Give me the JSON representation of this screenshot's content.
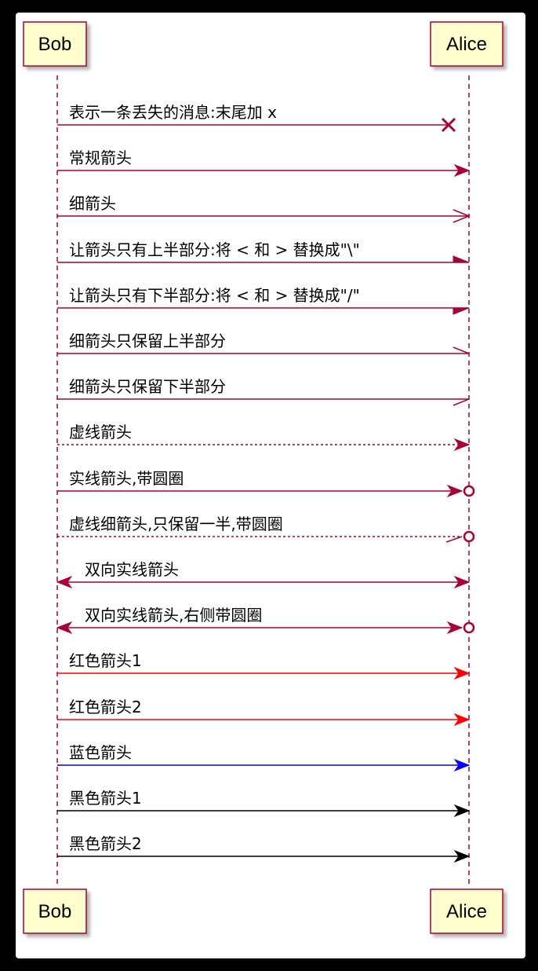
{
  "participants": [
    {
      "name": "Bob"
    },
    {
      "name": "Alice"
    }
  ],
  "colors": {
    "line": "#A80036",
    "box_fill": "#FEFECE",
    "red": "#FF0000",
    "blue": "#0000FF",
    "black": "#000000"
  },
  "messages": [
    {
      "text": "表示一条丢失的消息:末尾加 x",
      "style": "lost",
      "color": "line"
    },
    {
      "text": "常规箭头",
      "style": "solid",
      "color": "line"
    },
    {
      "text": "细箭头",
      "style": "thin",
      "color": "line"
    },
    {
      "text": "让箭头只有上半部分:将 < 和 > 替换成\"\\\"",
      "style": "half-top",
      "color": "line"
    },
    {
      "text": "让箭头只有下半部分:将 < 和 > 替换成\"/\"",
      "style": "half-bottom",
      "color": "line"
    },
    {
      "text": "细箭头只保留上半部分",
      "style": "thin-top",
      "color": "line"
    },
    {
      "text": "细箭头只保留下半部分",
      "style": "thin-bottom",
      "color": "line"
    },
    {
      "text": "虚线箭头",
      "style": "dashed",
      "color": "line"
    },
    {
      "text": "实线箭头,带圆圈",
      "style": "solid-circle",
      "color": "line"
    },
    {
      "text": "虚线细箭头,只保留一半,带圆圈",
      "style": "dashed-thin-half-circle",
      "color": "line"
    },
    {
      "text": "双向实线箭头",
      "style": "bidirectional",
      "color": "line"
    },
    {
      "text": "双向实线箭头,右侧带圆圈",
      "style": "bidirectional-circle",
      "color": "line"
    },
    {
      "text": "红色箭头1",
      "style": "solid",
      "color": "red"
    },
    {
      "text": "红色箭头2",
      "style": "solid",
      "color": "red"
    },
    {
      "text": "蓝色箭头",
      "style": "solid",
      "color": "blue"
    },
    {
      "text": "黑色箭头1",
      "style": "solid",
      "color": "black"
    },
    {
      "text": "黑色箭头2",
      "style": "solid",
      "color": "black"
    }
  ]
}
